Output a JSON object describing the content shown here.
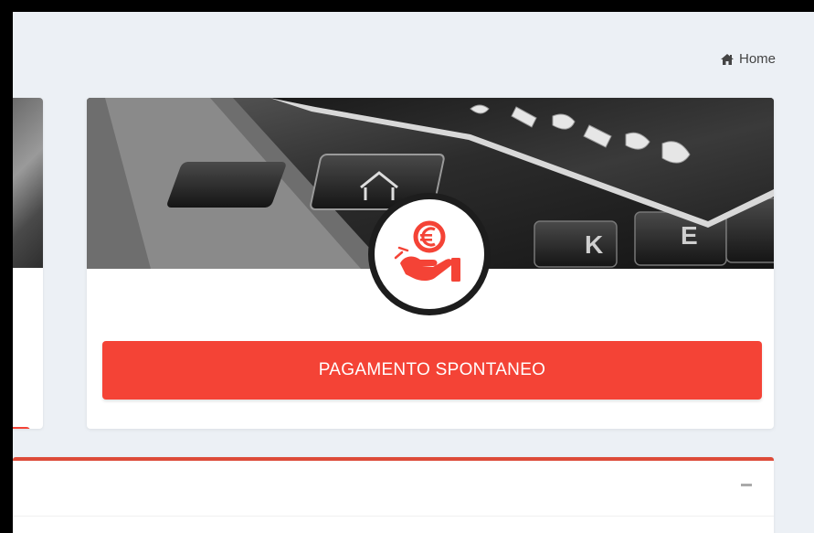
{
  "breadcrumb": {
    "home_icon": "home-icon",
    "home_label": "Home"
  },
  "main_card": {
    "banner_image": "credit-card-keyboard-photo",
    "center_icon": "euro-hand-icon",
    "button_label": "PAGAMENTO SPONTANEO",
    "accent_color": "#f44336"
  },
  "box": {
    "collapse_icon": "minus-icon",
    "border_color": "#dd4b39"
  }
}
